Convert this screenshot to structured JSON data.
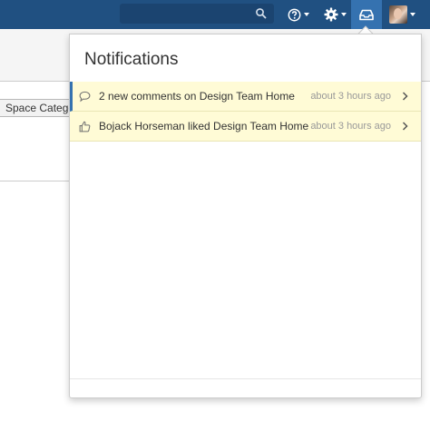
{
  "header": {
    "search_icon": "search-icon",
    "help_icon": "help-icon",
    "settings_icon": "gear-icon",
    "inbox_icon": "inbox-icon",
    "avatar": "user-avatar",
    "bar_color": "#205081",
    "active_color": "#3572b0"
  },
  "background": {
    "space_category_label": "Space Catego"
  },
  "notifications": {
    "title": "Notifications",
    "items": [
      {
        "icon": "comment-icon",
        "text": "2 new comments on Design Team Home",
        "time": "about 3 hours ago"
      },
      {
        "icon": "thumbs-up-icon",
        "text": "Bojack Horseman liked Design Team Home",
        "time": "about 3 hours ago"
      }
    ],
    "highlight_color": "#fffbd6"
  }
}
